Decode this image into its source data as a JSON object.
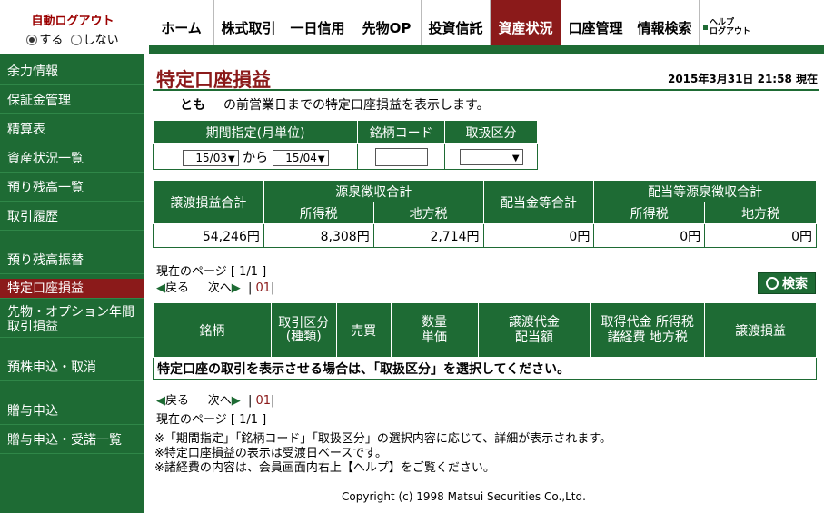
{
  "autologout": {
    "title": "自動ログアウト",
    "on_label": "する",
    "off_label": "しない"
  },
  "nav": {
    "items": [
      "ホーム",
      "株式取引",
      "一日信用",
      "先物OP",
      "投資信託",
      "資産状況",
      "口座管理",
      "情報検索"
    ],
    "help": [
      "ヘルプ",
      "ログアウト"
    ]
  },
  "sidebar": {
    "items": [
      "余力情報",
      "保証金管理",
      "精算表",
      "資産状況一覧",
      "預り残高一覧",
      "取引履歴",
      "預り残高振替",
      "特定口座損益",
      "先物・オプション年間取引損益",
      "預株申込・取消",
      "贈与申込",
      "贈与申込・受諾一覧"
    ]
  },
  "page": {
    "title": "特定口座損益",
    "datetime": "2015年3月31日 21:58 現在",
    "account": "とも",
    "intro": "の前営業日までの特定口座損益を表示します。"
  },
  "filter": {
    "headers": [
      "期間指定(月単位)",
      "銘柄コード",
      "取扱区分"
    ],
    "from": "15/03",
    "to": "15/04",
    "kara": "から",
    "code_value": "",
    "kubun_value": ""
  },
  "summary": {
    "h_total": "譲渡損益合計",
    "h_withholding": "源泉徴収合計",
    "h_income": "所得税",
    "h_local": "地方税",
    "h_dividend": "配当金等合計",
    "h_div_withholding": "配当等源泉徴収合計",
    "h_income2": "所得税",
    "h_local2": "地方税",
    "values": [
      "54,246円",
      "8,308円",
      "2,714円",
      "0円",
      "0円",
      "0円"
    ]
  },
  "pager": {
    "current": "現在のページ [ 1/1 ]",
    "prev": "戻る",
    "next": "次へ",
    "page": "01"
  },
  "search_button": "検索",
  "detail": {
    "headers": [
      "銘柄",
      "取引区分\n(種類)",
      "売買",
      "数量\n単価",
      "譲渡代金\n配当額",
      "取得代金 所得税\n諸経費 地方税",
      "譲渡損益"
    ],
    "message": "特定口座の取引を表示させる場合は、「取扱区分」を選択してください。"
  },
  "notes": [
    "※「期間指定」「銘柄コード」「取扱区分」の選択内容に応じて、詳細が表示されます。",
    "※特定口座損益の表示は受渡日ベースです。",
    "※諸経費の内容は、会員画面内右上【ヘルプ】をご覧ください。"
  ],
  "copyright": "Copyright (c) 1998 Matsui Securities Co.,Ltd."
}
